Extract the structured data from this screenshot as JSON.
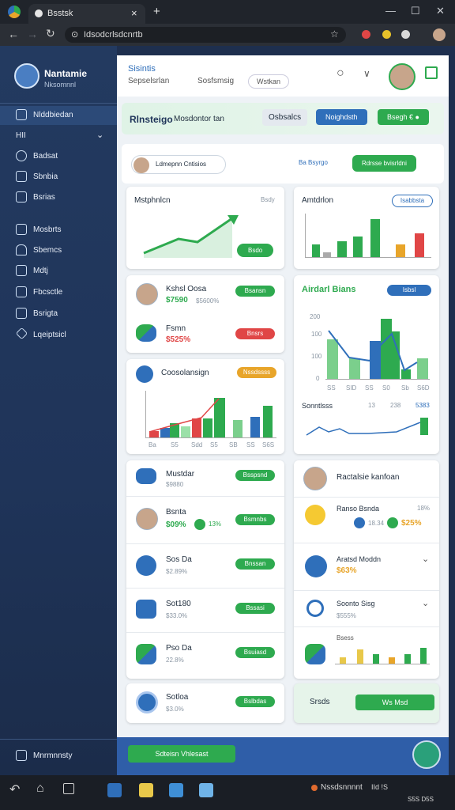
{
  "browser": {
    "tab_title": "Bsstsk",
    "url": "Idsodcrlsdcnrtb",
    "new_tab": "+",
    "close_tab": "×"
  },
  "sidebar": {
    "user_name": "Nantamie",
    "user_sub": "Nksomnnl",
    "items": [
      {
        "label": "Nlddbiedan",
        "icon": "dashboard-icon"
      },
      {
        "label": "HII",
        "icon": "none"
      },
      {
        "label": "Badsat",
        "icon": "user-icon"
      },
      {
        "label": "Sbnbia",
        "icon": "chart-icon"
      },
      {
        "label": "Bsrias",
        "icon": "file-icon"
      },
      {
        "label": "Mosbrts",
        "icon": "book-icon"
      },
      {
        "label": "Sbemcs",
        "icon": "bell-icon"
      },
      {
        "label": "Mdtj",
        "icon": "chat-icon"
      },
      {
        "label": "Fbcsctle",
        "icon": "table-icon"
      },
      {
        "label": "Bsrigta",
        "icon": "calendar-icon"
      },
      {
        "label": "Lqeiptsicl",
        "icon": "shield-icon"
      }
    ],
    "footer": "Mnrmnnsty"
  },
  "header": {
    "title": "Sisintis",
    "tab1": "Sepselsrlan",
    "tab2": "Sosfsmsig",
    "tab3": "Wstkan"
  },
  "banner": {
    "title": "Rlnsteigo",
    "sub": "Mosdontor tan",
    "btn1": "Osbsalcs",
    "btn2": "Noighdsth",
    "btn3": "Bsegh €  ●"
  },
  "filter": {
    "chip": "Ldmepnn Cntisios",
    "by": "Ba Bsyrgo",
    "action": "Rdrsse bvisrldni"
  },
  "card1": {
    "title": "Mstphnlcn",
    "meta": "Bsdy",
    "btn": "Bsdo"
  },
  "card2": {
    "title": "Amtdrlon",
    "chip": "Isabbsta"
  },
  "card3": {
    "name": "Kshsl Oosa",
    "value": "$7590",
    "sub": "$5600%",
    "btn": "Bsansn",
    "name2": "Fsmn",
    "value2": "$525%",
    "btn2": "Bnsrs"
  },
  "card4": {
    "title": "Airdarl Bians",
    "chip": "Isbsl",
    "y": [
      "200",
      "100",
      "100",
      "0"
    ],
    "x": [
      "SS",
      "SID",
      "SS",
      "S0",
      "Sb",
      "S6D"
    ],
    "sub": "Sonntlsss",
    "v1": "13",
    "v2": "238",
    "v3": "5383"
  },
  "card5": {
    "title": "Coosolansign",
    "chip": "Nssdssss",
    "x": [
      "Ba",
      "S5",
      "Sdd",
      "S5",
      "SB",
      "SS",
      "S6S"
    ]
  },
  "list_left": [
    {
      "name": "Mustdar",
      "val": "$9880",
      "btn": "Bsspsnd"
    },
    {
      "name": "Bsnta",
      "val": "$09%",
      "extra": "13%",
      "btn": "Bsmnbs"
    },
    {
      "name": "Sos Da",
      "val": "$2.89%",
      "btn": "Bnssan"
    },
    {
      "name": "Sot180",
      "val": "$33.0%",
      "btn": "Bssasi"
    },
    {
      "name": "Pso Da",
      "val": "22.8%",
      "btn": "Bsuiasd"
    },
    {
      "name": "Sotloa",
      "val": "$3.0%",
      "btn": "Bslbdas"
    }
  ],
  "list_right": {
    "title": "Ractalsie kanfoan",
    "r1": {
      "name": "Ranso Bsnda",
      "pct": "18%",
      "v1": "18.34",
      "v2": "$25%"
    },
    "r2": {
      "name": "Aratsd Moddn",
      "val": "$63%"
    },
    "r3": {
      "name": "Soonto Sisg",
      "val": "$555%"
    },
    "r4": {
      "name": "Bsess"
    },
    "footer_label": "Srsds",
    "footer_btn": "Ws Msd"
  },
  "bottom": {
    "btn": "Sdteisn Vhlesast"
  },
  "taskbar": {
    "status": "Nssdsnnnnt",
    "ctl": "IId  ǃS",
    "time": "S5S D5S"
  },
  "colors": {
    "green": "#2eaa4f",
    "blue": "#2f6fba",
    "red": "#e04646",
    "orange": "#e8a52a",
    "navy": "#233a60"
  },
  "chart_data": [
    {
      "type": "line",
      "title": "Mstphnlcn",
      "values": [
        2,
        4,
        3,
        8
      ]
    },
    {
      "type": "bar",
      "title": "Amtdrlon",
      "values": [
        3,
        1,
        4,
        9,
        2,
        5
      ]
    },
    {
      "type": "bar",
      "title": "Airdarl Bians",
      "values": [
        95,
        45,
        30,
        90,
        150,
        30,
        70
      ]
    },
    {
      "type": "bar",
      "title": "Coosolansign",
      "values": [
        10,
        14,
        22,
        30,
        50,
        22,
        38,
        26,
        20,
        40
      ]
    }
  ]
}
